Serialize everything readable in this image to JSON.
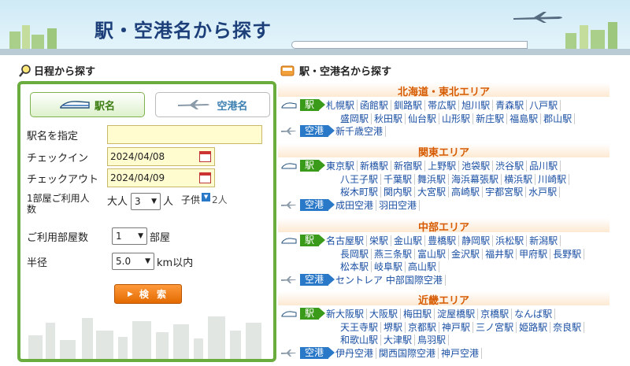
{
  "banner": {
    "title": "駅・空港名から探す"
  },
  "left": {
    "heading": "日程から探す",
    "tabs": [
      {
        "label": "駅名"
      },
      {
        "label": "空港名"
      }
    ],
    "station_label": "駅名を指定",
    "station_value": "",
    "checkin_label": "チェックイン",
    "checkin_value": "2024/04/08",
    "checkout_label": "チェックアウト",
    "checkout_value": "2024/04/09",
    "guests_label_1": "1部屋ご利用人",
    "guests_label_2": "数",
    "adults_label": "大人",
    "adults_value": "3",
    "adults_unit": "人",
    "children_label": "子供",
    "children_value": "2人",
    "rooms_label": "ご利用部屋数",
    "rooms_value": "1",
    "rooms_unit": "部屋",
    "radius_label": "半径",
    "radius_value": "5.0",
    "radius_unit": "km以内",
    "search_label": "検 索"
  },
  "right": {
    "heading": "駅・空港名から探す",
    "station_tag": "駅",
    "airport_tag": "空港",
    "regions": [
      {
        "title": "北海道・東北エリア",
        "stations_l1": [
          "札幌駅",
          "函館駅",
          "釧路駅",
          "帯広駅",
          "旭川駅",
          "青森駅",
          "八戸駅"
        ],
        "stations_l2": [
          "盛岡駅",
          "秋田駅",
          "仙台駅",
          "山形駅",
          "新庄駅",
          "福島駅",
          "郡山駅"
        ],
        "stations_l3": [],
        "airports": [
          "新千歳空港"
        ]
      },
      {
        "title": "関東エリア",
        "stations_l1": [
          "東京駅",
          "新橋駅",
          "新宿駅",
          "上野駅",
          "池袋駅",
          "渋谷駅",
          "品川駅"
        ],
        "stations_l2": [
          "八王子駅",
          "千葉駅",
          "舞浜駅",
          "海浜幕張駅",
          "横浜駅",
          "川崎駅"
        ],
        "stations_l3": [
          "桜木町駅",
          "関内駅",
          "大宮駅",
          "高崎駅",
          "宇都宮駅",
          "水戸駅"
        ],
        "airports": [
          "成田空港",
          "羽田空港"
        ]
      },
      {
        "title": "中部エリア",
        "stations_l1": [
          "名古屋駅",
          "栄駅",
          "金山駅",
          "豊橋駅",
          "静岡駅",
          "浜松駅",
          "新潟駅"
        ],
        "stations_l2": [
          "長岡駅",
          "燕三条駅",
          "富山駅",
          "金沢駅",
          "福井駅",
          "甲府駅",
          "長野駅"
        ],
        "stations_l3": [
          "松本駅",
          "岐阜駅",
          "高山駅"
        ],
        "airports": [
          "セントレア 中部国際空港"
        ]
      },
      {
        "title": "近畿エリア",
        "stations_l1": [
          "新大阪駅",
          "大阪駅",
          "梅田駅",
          "淀屋橋駅",
          "京橋駅",
          "なんば駅"
        ],
        "stations_l2": [
          "天王寺駅",
          "堺駅",
          "京都駅",
          "神戸駅",
          "三ノ宮駅",
          "姫路駅",
          "奈良駅"
        ],
        "stations_l3": [
          "和歌山駅",
          "大津駅",
          "鳥羽駅"
        ],
        "airports": [
          "伊丹空港",
          "関西国際空港",
          "神戸空港"
        ]
      }
    ]
  },
  "colors": {
    "green": "#6aac3e",
    "orange": "#e36a00",
    "region_title": "#d65b00",
    "link": "#1a4fa3"
  }
}
